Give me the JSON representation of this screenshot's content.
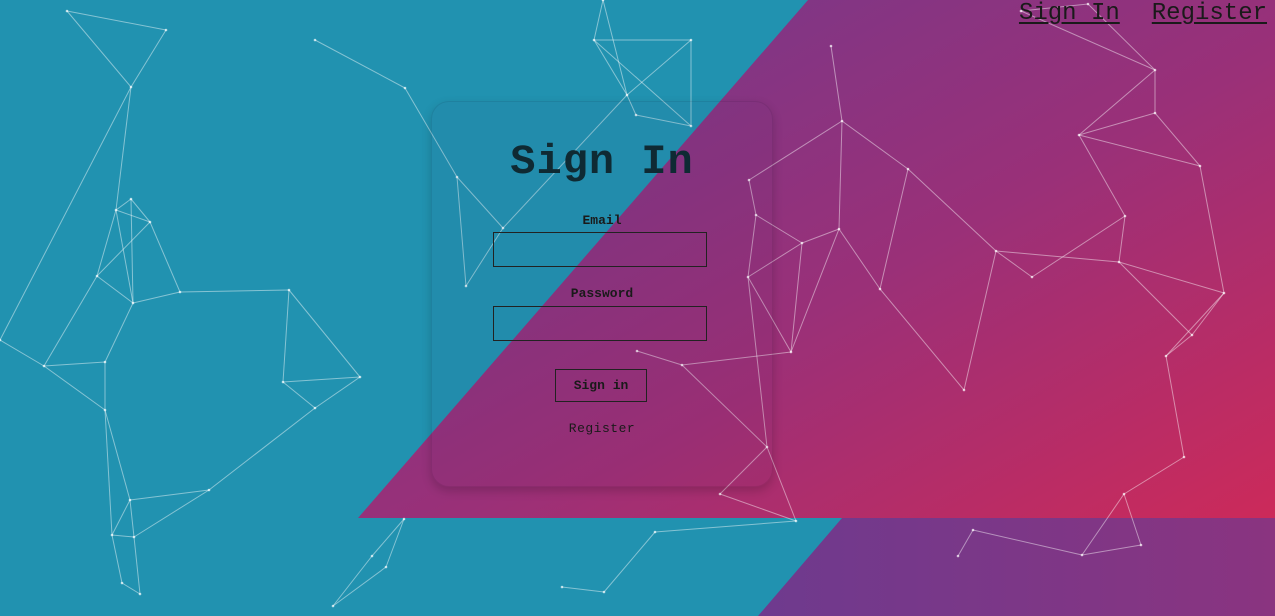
{
  "nav": {
    "sign_in": "Sign In",
    "register": "Register"
  },
  "form": {
    "title": "Sign In",
    "email_label": "Email",
    "email_value": "",
    "password_label": "Password",
    "password_value": "",
    "submit_label": "Sign in",
    "register_link": "Register"
  },
  "colors": {
    "background_teal": "#2192b0",
    "gradient_start": "#7a3a8a",
    "gradient_end": "#cc2a5a",
    "text_dark": "#1a1a1a"
  }
}
